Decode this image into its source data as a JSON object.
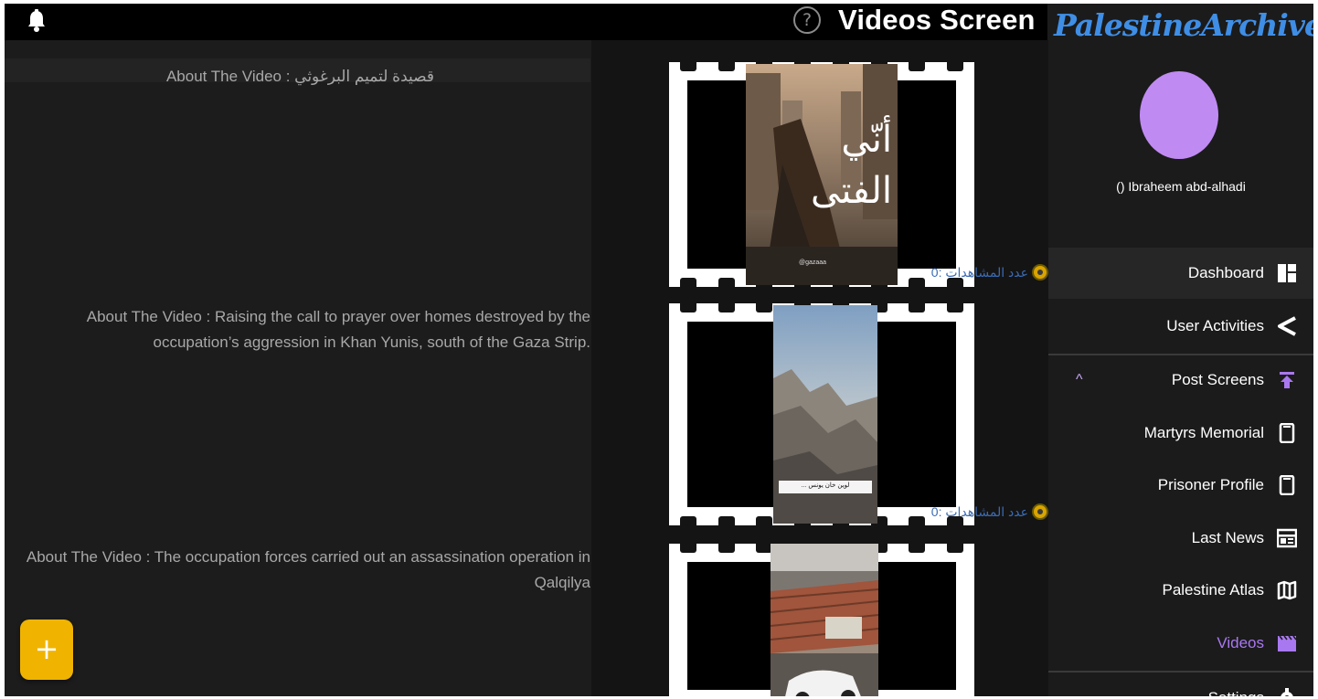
{
  "header": {
    "title": "Videos Screen",
    "help_glyph": "?"
  },
  "brand": {
    "name": "PalestineArchive"
  },
  "user": {
    "display_name": "() Ibraheem abd-alhadi"
  },
  "nav": {
    "dashboard": "Dashboard",
    "user_activities": "User Activities",
    "post_screens": "Post Screens",
    "martyrs_memorial": "Martyrs Memorial",
    "prisoner_profile": "Prisoner Profile",
    "last_news": "Last News",
    "palestine_atlas": "Palestine Atlas",
    "videos": "Videos",
    "settings": "Settings"
  },
  "videos": [
    {
      "about": "About The Video : قصيدة لتميم البرغوثي",
      "views_label": "عدد المشاهدات :0",
      "overlay_text": "أنّي الفتى",
      "watermark": "@gazaaa"
    },
    {
      "about_line1": "About The Video : Raising the call to prayer over homes destroyed by the",
      "about_line2": "occupation’s aggression in Khan Yunis, south of the Gaza Strip.",
      "views_label": "عدد المشاهدات :0",
      "caption": "لوين خان يونس ... "
    },
    {
      "about_line1": "About The Video : The occupation forces carried out an assassination operation in",
      "about_line2": "Qalqilya"
    }
  ],
  "fab": {
    "label": "+"
  },
  "colors": {
    "accent_purple": "#a878f0",
    "fab_yellow": "#f0b400",
    "brand_blue": "#3f8ee6",
    "avatar": "#c08af3"
  },
  "icons": {
    "bell": "bell-icon",
    "help": "help-circle-icon",
    "dashboard": "dashboard-icon",
    "user_activities": "share-icon",
    "post_screens": "upload-icon",
    "martyrs_memorial": "phone-icon",
    "prisoner_profile": "phone-icon",
    "last_news": "newspaper-icon",
    "palestine_atlas": "map-icon",
    "videos": "clapperboard-icon",
    "settings": "gear-icon",
    "views": "eye-icon",
    "expand": "chevron-up-icon",
    "add": "plus-icon"
  }
}
